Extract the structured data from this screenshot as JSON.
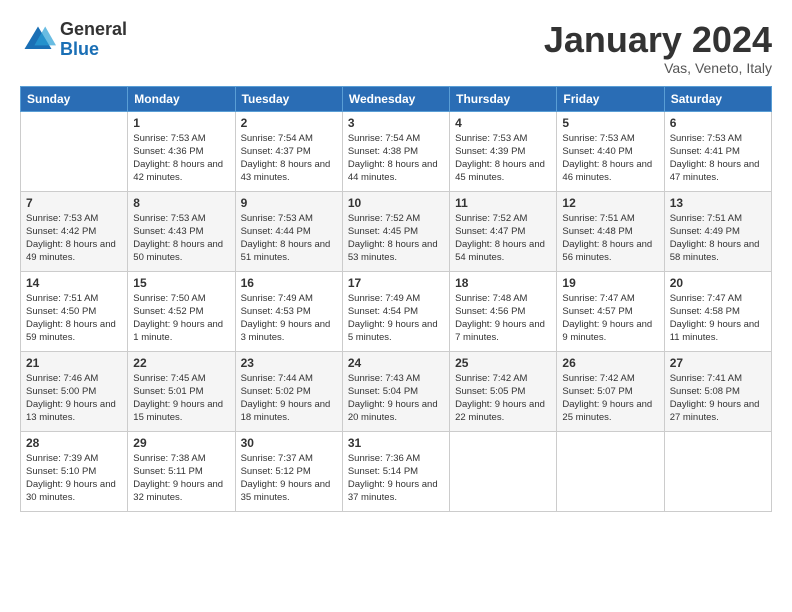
{
  "logo": {
    "general": "General",
    "blue": "Blue"
  },
  "header": {
    "title": "January 2024",
    "subtitle": "Vas, Veneto, Italy"
  },
  "weekdays": [
    "Sunday",
    "Monday",
    "Tuesday",
    "Wednesday",
    "Thursday",
    "Friday",
    "Saturday"
  ],
  "weeks": [
    [
      null,
      {
        "day": "1",
        "sunrise": "7:53 AM",
        "sunset": "4:36 PM",
        "daylight": "8 hours and 42 minutes."
      },
      {
        "day": "2",
        "sunrise": "7:54 AM",
        "sunset": "4:37 PM",
        "daylight": "8 hours and 43 minutes."
      },
      {
        "day": "3",
        "sunrise": "7:54 AM",
        "sunset": "4:38 PM",
        "daylight": "8 hours and 44 minutes."
      },
      {
        "day": "4",
        "sunrise": "7:53 AM",
        "sunset": "4:39 PM",
        "daylight": "8 hours and 45 minutes."
      },
      {
        "day": "5",
        "sunrise": "7:53 AM",
        "sunset": "4:40 PM",
        "daylight": "8 hours and 46 minutes."
      },
      {
        "day": "6",
        "sunrise": "7:53 AM",
        "sunset": "4:41 PM",
        "daylight": "8 hours and 47 minutes."
      }
    ],
    [
      {
        "day": "7",
        "sunrise": "7:53 AM",
        "sunset": "4:42 PM",
        "daylight": "8 hours and 49 minutes."
      },
      {
        "day": "8",
        "sunrise": "7:53 AM",
        "sunset": "4:43 PM",
        "daylight": "8 hours and 50 minutes."
      },
      {
        "day": "9",
        "sunrise": "7:53 AM",
        "sunset": "4:44 PM",
        "daylight": "8 hours and 51 minutes."
      },
      {
        "day": "10",
        "sunrise": "7:52 AM",
        "sunset": "4:45 PM",
        "daylight": "8 hours and 53 minutes."
      },
      {
        "day": "11",
        "sunrise": "7:52 AM",
        "sunset": "4:47 PM",
        "daylight": "8 hours and 54 minutes."
      },
      {
        "day": "12",
        "sunrise": "7:51 AM",
        "sunset": "4:48 PM",
        "daylight": "8 hours and 56 minutes."
      },
      {
        "day": "13",
        "sunrise": "7:51 AM",
        "sunset": "4:49 PM",
        "daylight": "8 hours and 58 minutes."
      }
    ],
    [
      {
        "day": "14",
        "sunrise": "7:51 AM",
        "sunset": "4:50 PM",
        "daylight": "8 hours and 59 minutes."
      },
      {
        "day": "15",
        "sunrise": "7:50 AM",
        "sunset": "4:52 PM",
        "daylight": "9 hours and 1 minute."
      },
      {
        "day": "16",
        "sunrise": "7:49 AM",
        "sunset": "4:53 PM",
        "daylight": "9 hours and 3 minutes."
      },
      {
        "day": "17",
        "sunrise": "7:49 AM",
        "sunset": "4:54 PM",
        "daylight": "9 hours and 5 minutes."
      },
      {
        "day": "18",
        "sunrise": "7:48 AM",
        "sunset": "4:56 PM",
        "daylight": "9 hours and 7 minutes."
      },
      {
        "day": "19",
        "sunrise": "7:47 AM",
        "sunset": "4:57 PM",
        "daylight": "9 hours and 9 minutes."
      },
      {
        "day": "20",
        "sunrise": "7:47 AM",
        "sunset": "4:58 PM",
        "daylight": "9 hours and 11 minutes."
      }
    ],
    [
      {
        "day": "21",
        "sunrise": "7:46 AM",
        "sunset": "5:00 PM",
        "daylight": "9 hours and 13 minutes."
      },
      {
        "day": "22",
        "sunrise": "7:45 AM",
        "sunset": "5:01 PM",
        "daylight": "9 hours and 15 minutes."
      },
      {
        "day": "23",
        "sunrise": "7:44 AM",
        "sunset": "5:02 PM",
        "daylight": "9 hours and 18 minutes."
      },
      {
        "day": "24",
        "sunrise": "7:43 AM",
        "sunset": "5:04 PM",
        "daylight": "9 hours and 20 minutes."
      },
      {
        "day": "25",
        "sunrise": "7:42 AM",
        "sunset": "5:05 PM",
        "daylight": "9 hours and 22 minutes."
      },
      {
        "day": "26",
        "sunrise": "7:42 AM",
        "sunset": "5:07 PM",
        "daylight": "9 hours and 25 minutes."
      },
      {
        "day": "27",
        "sunrise": "7:41 AM",
        "sunset": "5:08 PM",
        "daylight": "9 hours and 27 minutes."
      }
    ],
    [
      {
        "day": "28",
        "sunrise": "7:39 AM",
        "sunset": "5:10 PM",
        "daylight": "9 hours and 30 minutes."
      },
      {
        "day": "29",
        "sunrise": "7:38 AM",
        "sunset": "5:11 PM",
        "daylight": "9 hours and 32 minutes."
      },
      {
        "day": "30",
        "sunrise": "7:37 AM",
        "sunset": "5:12 PM",
        "daylight": "9 hours and 35 minutes."
      },
      {
        "day": "31",
        "sunrise": "7:36 AM",
        "sunset": "5:14 PM",
        "daylight": "9 hours and 37 minutes."
      },
      null,
      null,
      null
    ]
  ],
  "labels": {
    "sunrise": "Sunrise:",
    "sunset": "Sunset:",
    "daylight": "Daylight:"
  }
}
